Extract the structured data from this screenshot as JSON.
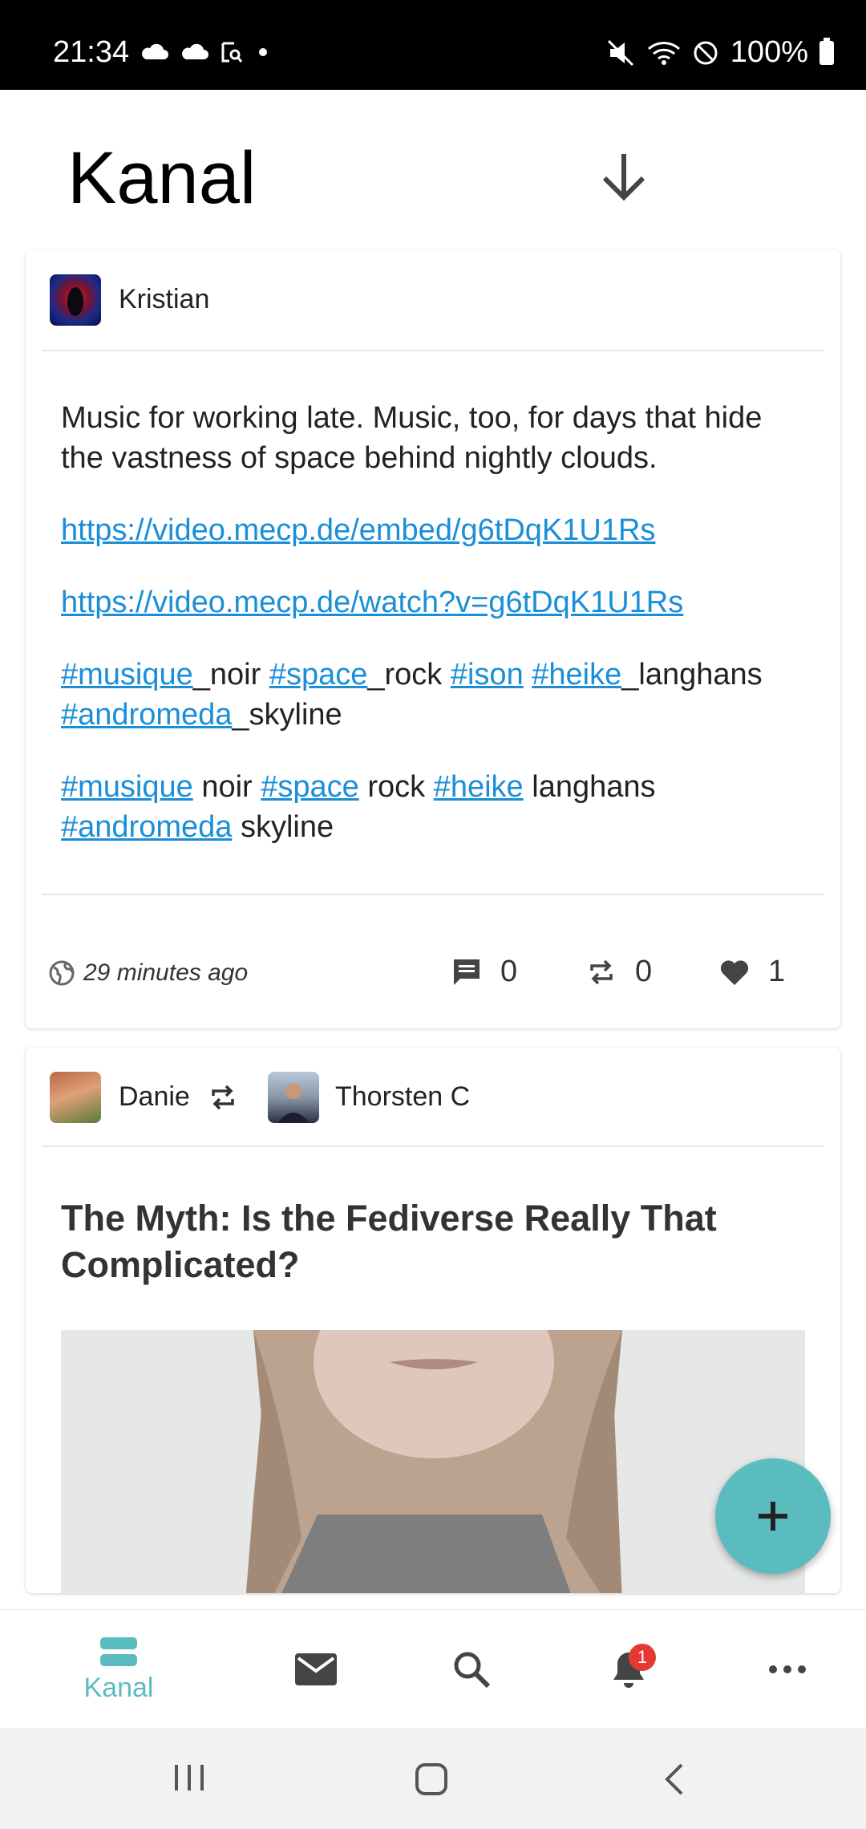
{
  "status_bar": {
    "time": "21:34",
    "battery": "100%"
  },
  "header": {
    "title": "Kanal"
  },
  "posts": [
    {
      "author": "Kristian",
      "body": {
        "line1": "Music for working late. Music, too, for days that hide the vastness of space behind nightly clouds.",
        "link1": "https://video.mecp.de/embed/g6tDqK1U1Rs",
        "link2": "https://video.mecp.de/watch?v=g6tDqK1U1Rs",
        "tags1": [
          {
            "tag": "#musique",
            "rest": "_noir "
          },
          {
            "tag": "#space",
            "rest": "_rock "
          },
          {
            "tag": "#ison",
            "rest": " "
          },
          {
            "tag": "#heike",
            "rest": "_langhans "
          },
          {
            "tag": "#andromeda",
            "rest": "_skyline"
          }
        ],
        "tags2": [
          {
            "tag": "#musique",
            "rest": " noir "
          },
          {
            "tag": "#space",
            "rest": " rock "
          },
          {
            "tag": "#heike",
            "rest": " langhans "
          },
          {
            "tag": "#andromeda",
            "rest": " skyline"
          }
        ]
      },
      "time_ago": "29 minutes ago",
      "comments": "0",
      "reshares": "0",
      "likes": "1"
    },
    {
      "resharer": "Danie",
      "author": "Thorsten C",
      "title": "The Myth: Is the Fediverse Really That Complicated?"
    }
  ],
  "bottom_nav": {
    "items": [
      {
        "label": "Kanal",
        "icon": "stream-icon"
      },
      {
        "icon": "mail-icon"
      },
      {
        "icon": "search-icon"
      },
      {
        "icon": "bell-icon",
        "badge": "1"
      },
      {
        "icon": "more-icon"
      }
    ]
  },
  "colors": {
    "accent": "#5bbcbf",
    "link": "#1a8fd8",
    "badge": "#e53935"
  }
}
